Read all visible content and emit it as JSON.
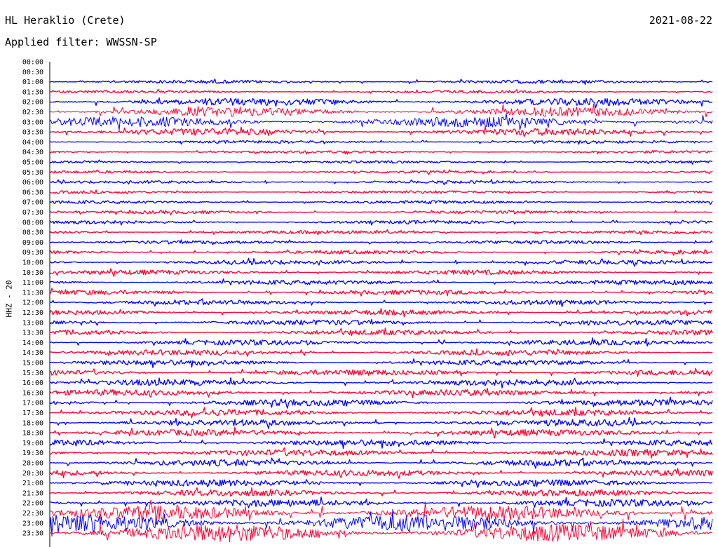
{
  "header": {
    "station": "HL Heraklio (Crete)",
    "date": "2021-08-22",
    "filter_prefix": "Applied filter:",
    "filter_name": "WWSSN-SP"
  },
  "channel_label": "HHZ - 20",
  "colors": {
    "trace_a": "#0000ff",
    "trace_b": "#ff0033",
    "axis": "#000000"
  },
  "chart_data": {
    "type": "line",
    "title": "HL Heraklio (Crete)",
    "ylabel": "HHZ - 20",
    "row_labels": [
      "00:00",
      "00:30",
      "01:00",
      "01:30",
      "02:00",
      "02:30",
      "03:00",
      "03:30",
      "04:00",
      "04:30",
      "05:00",
      "05:30",
      "06:00",
      "06:30",
      "07:00",
      "07:30",
      "08:00",
      "08:30",
      "09:00",
      "09:30",
      "10:00",
      "10:30",
      "11:00",
      "11:30",
      "12:00",
      "12:30",
      "13:00",
      "13:30",
      "14:00",
      "14:30",
      "15:00",
      "15:30",
      "16:00",
      "16:30",
      "17:00",
      "17:30",
      "18:00",
      "18:30",
      "19:00",
      "19:30",
      "20:00",
      "20:30",
      "21:00",
      "21:30",
      "22:00",
      "22:30",
      "23:00",
      "23:30"
    ],
    "trace_colors_alternate": [
      "blue",
      "red"
    ],
    "relative_amplitude": [
      0,
      0,
      0.6,
      0.5,
      1.3,
      1.6,
      1.8,
      1.2,
      0.5,
      0.45,
      0.45,
      0.45,
      0.5,
      0.5,
      0.55,
      0.55,
      0.6,
      0.6,
      0.6,
      0.6,
      0.75,
      0.8,
      0.8,
      0.8,
      0.8,
      0.85,
      0.9,
      0.9,
      0.9,
      0.95,
      0.95,
      1.0,
      1.05,
      1.05,
      1.1,
      1.1,
      1.1,
      1.1,
      1.1,
      1.1,
      1.1,
      1.1,
      1.1,
      1.1,
      1.2,
      2.5,
      3.0,
      3.0
    ]
  }
}
